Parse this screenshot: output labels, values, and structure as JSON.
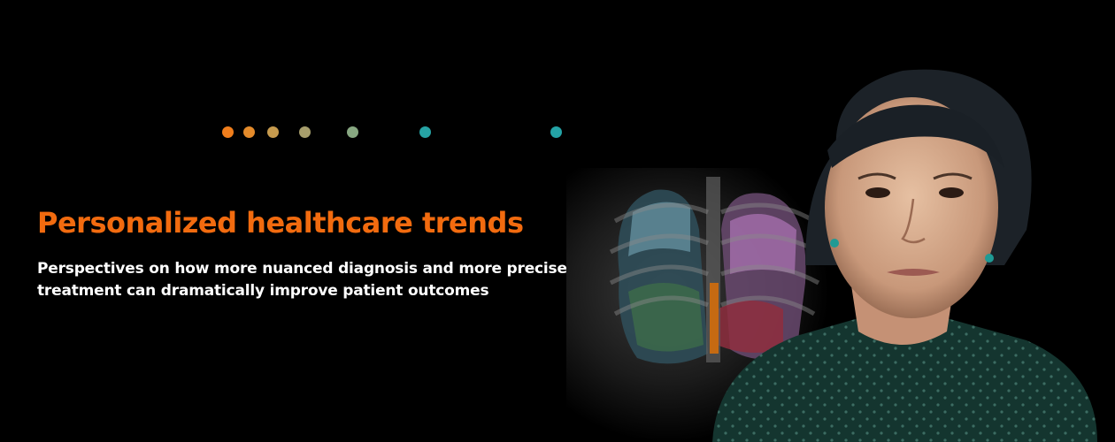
{
  "hero": {
    "title": "Personalized healthcare trends",
    "subtitle": "Perspectives on how more nuanced diagnosis and more precise treatment can dramatically improve patient outcomes",
    "title_color": "#f26b0f",
    "subtitle_color": "#ffffff",
    "background_color": "#000000",
    "image_description_icon": "portrait-with-lung-xray-image"
  },
  "decoration": {
    "dot_colors": [
      "#f07e1c",
      "#e48b2b",
      "#c79b4e",
      "#a79e6c",
      "#88a882",
      "#26a3a4",
      "#24a3a6"
    ]
  }
}
